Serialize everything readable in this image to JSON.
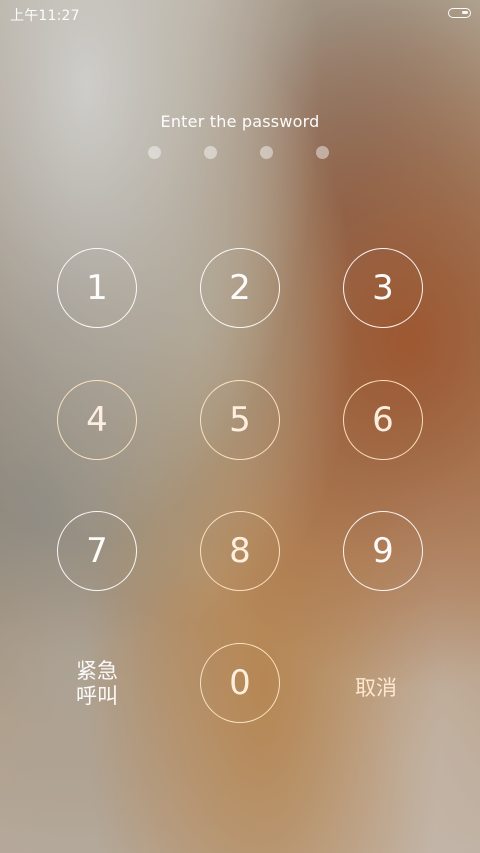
{
  "status_bar": {
    "time": "上午11:27",
    "battery_icon": "battery-icon"
  },
  "lock_screen": {
    "prompt": "Enter the password",
    "entered_digits": 0,
    "max_digits": 4
  },
  "keypad": {
    "keys": [
      {
        "label": "1"
      },
      {
        "label": "2"
      },
      {
        "label": "3"
      },
      {
        "label": "4"
      },
      {
        "label": "5"
      },
      {
        "label": "6"
      },
      {
        "label": "7"
      },
      {
        "label": "8"
      },
      {
        "label": "9"
      },
      {
        "label": "0"
      }
    ],
    "emergency_call_line1": "紧急",
    "emergency_call_line2": "呼叫",
    "cancel": "取消"
  }
}
